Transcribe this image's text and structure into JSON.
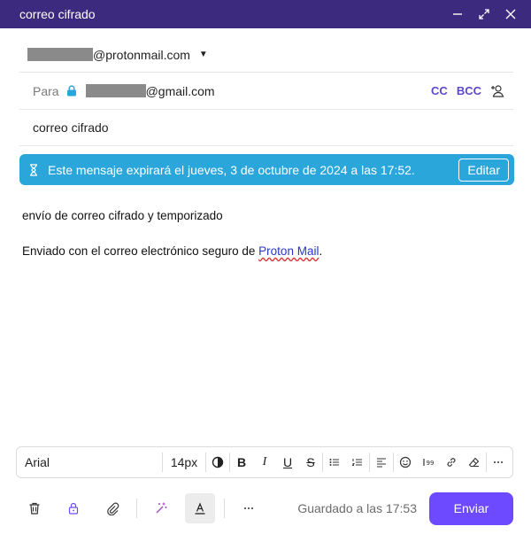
{
  "window": {
    "title": "correo cifrado"
  },
  "from": {
    "address_suffix": "@protonmail.com"
  },
  "to": {
    "label": "Para",
    "address_suffix": "@gmail.com",
    "cc_label": "CC",
    "bcc_label": "BCC"
  },
  "subject": {
    "value": "correo cifrado"
  },
  "expiration": {
    "message": "Este mensaje expirará el jueves, 3 de octubre de 2024 a las 17:52.",
    "edit_label": "Editar",
    "color": "#2aa6db"
  },
  "body": {
    "line1": "envío de correo cifrado y temporizado",
    "line2_prefix": "Enviado con el correo electrónico seguro de ",
    "link_text": "Proton Mail",
    "line2_suffix": "."
  },
  "toolbar": {
    "font": "Arial",
    "size": "14px"
  },
  "footer": {
    "saved_text": "Guardado a las 17:53",
    "send_label": "Enviar",
    "accent": "#6d4aff"
  }
}
